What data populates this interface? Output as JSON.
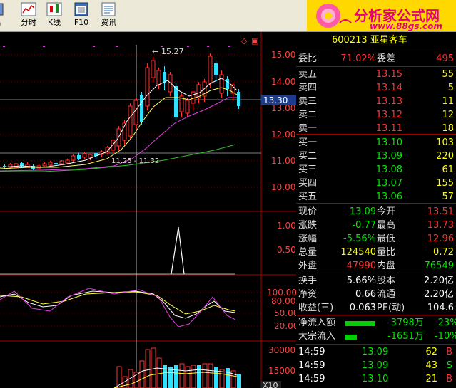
{
  "toolbar": {
    "buttons": [
      {
        "label": "出",
        "icon": "exit-icon"
      },
      {
        "label": "分时",
        "icon": "timeshare-chart-icon"
      },
      {
        "label": "K线",
        "icon": "candlestick-icon"
      },
      {
        "label": "F10",
        "icon": "f10-icon"
      },
      {
        "label": "资讯",
        "icon": "news-icon"
      }
    ],
    "logo_text": "分析家公式网",
    "logo_url": "www.88gs.com"
  },
  "stock": {
    "code_name": "600213 亚星客车"
  },
  "price_axis": [
    "15.00",
    "14.00",
    "13.00",
    "12.00",
    "11.00",
    "10.00"
  ],
  "current_price_tag": "13.30",
  "chart_annotations": {
    "high": "15.27",
    "low": "11.25 - 11.32"
  },
  "vol_ratio_axis": [
    "1.00",
    "0.50"
  ],
  "kdj_axis": [
    "100.00",
    "80.00",
    "50.00",
    "20.00"
  ],
  "volume_axis": [
    "30000",
    "15000"
  ],
  "volume_unit": "X10",
  "order_book": {
    "weibi_label": "委比",
    "weibi": "71.02%",
    "weicha_label": "委差",
    "weicha": "495",
    "asks": [
      {
        "label": "卖五",
        "price": "13.15",
        "vol": "55"
      },
      {
        "label": "卖四",
        "price": "13.14",
        "vol": "5"
      },
      {
        "label": "卖三",
        "price": "13.13",
        "vol": "11"
      },
      {
        "label": "卖二",
        "price": "13.12",
        "vol": "12"
      },
      {
        "label": "卖一",
        "price": "13.11",
        "vol": "18"
      }
    ],
    "bids": [
      {
        "label": "买一",
        "price": "13.10",
        "vol": "103"
      },
      {
        "label": "买二",
        "price": "13.09",
        "vol": "220"
      },
      {
        "label": "买三",
        "price": "13.08",
        "vol": "61"
      },
      {
        "label": "买四",
        "price": "13.07",
        "vol": "155"
      },
      {
        "label": "买五",
        "price": "13.06",
        "vol": "57"
      }
    ]
  },
  "quote": [
    {
      "l1": "现价",
      "v1": "13.09",
      "l2": "今开",
      "v2": "13.51"
    },
    {
      "l1": "涨跌",
      "v1": "-0.77",
      "l2": "最高",
      "v2": "13.73"
    },
    {
      "l1": "涨幅",
      "v1": "-5.56%",
      "l2": "最低",
      "v2": "12.96"
    },
    {
      "l1": "总量",
      "v1": "124540",
      "l2": "量比",
      "v2": "0.72"
    },
    {
      "l1": "外盘",
      "v1": "47990",
      "l2": "内盘",
      "v2": "76549"
    }
  ],
  "fundamentals": [
    {
      "l1": "换手",
      "v1": "5.66%",
      "l2": "股本",
      "v2": "2.20亿"
    },
    {
      "l1": "净资",
      "v1": "0.66",
      "l2": "流通",
      "v2": "2.20亿"
    },
    {
      "l1": "收益(三)",
      "v1": "0.063",
      "l2": "PE(动)",
      "v2": "104.6"
    }
  ],
  "flows": [
    {
      "label": "净流入额",
      "value": "-3798万",
      "pct": "-23%",
      "bar_fraction": 0.9
    },
    {
      "label": "大宗流入",
      "value": "-1651万",
      "pct": "-10%",
      "bar_fraction": 0.35
    }
  ],
  "ticks": [
    {
      "time": "14:59",
      "price": "13.09",
      "vol": "62",
      "side": "B"
    },
    {
      "time": "14:59",
      "price": "13.09",
      "vol": "43",
      "side": "S"
    },
    {
      "time": "14:59",
      "price": "13.10",
      "vol": "21",
      "side": "B"
    }
  ]
}
